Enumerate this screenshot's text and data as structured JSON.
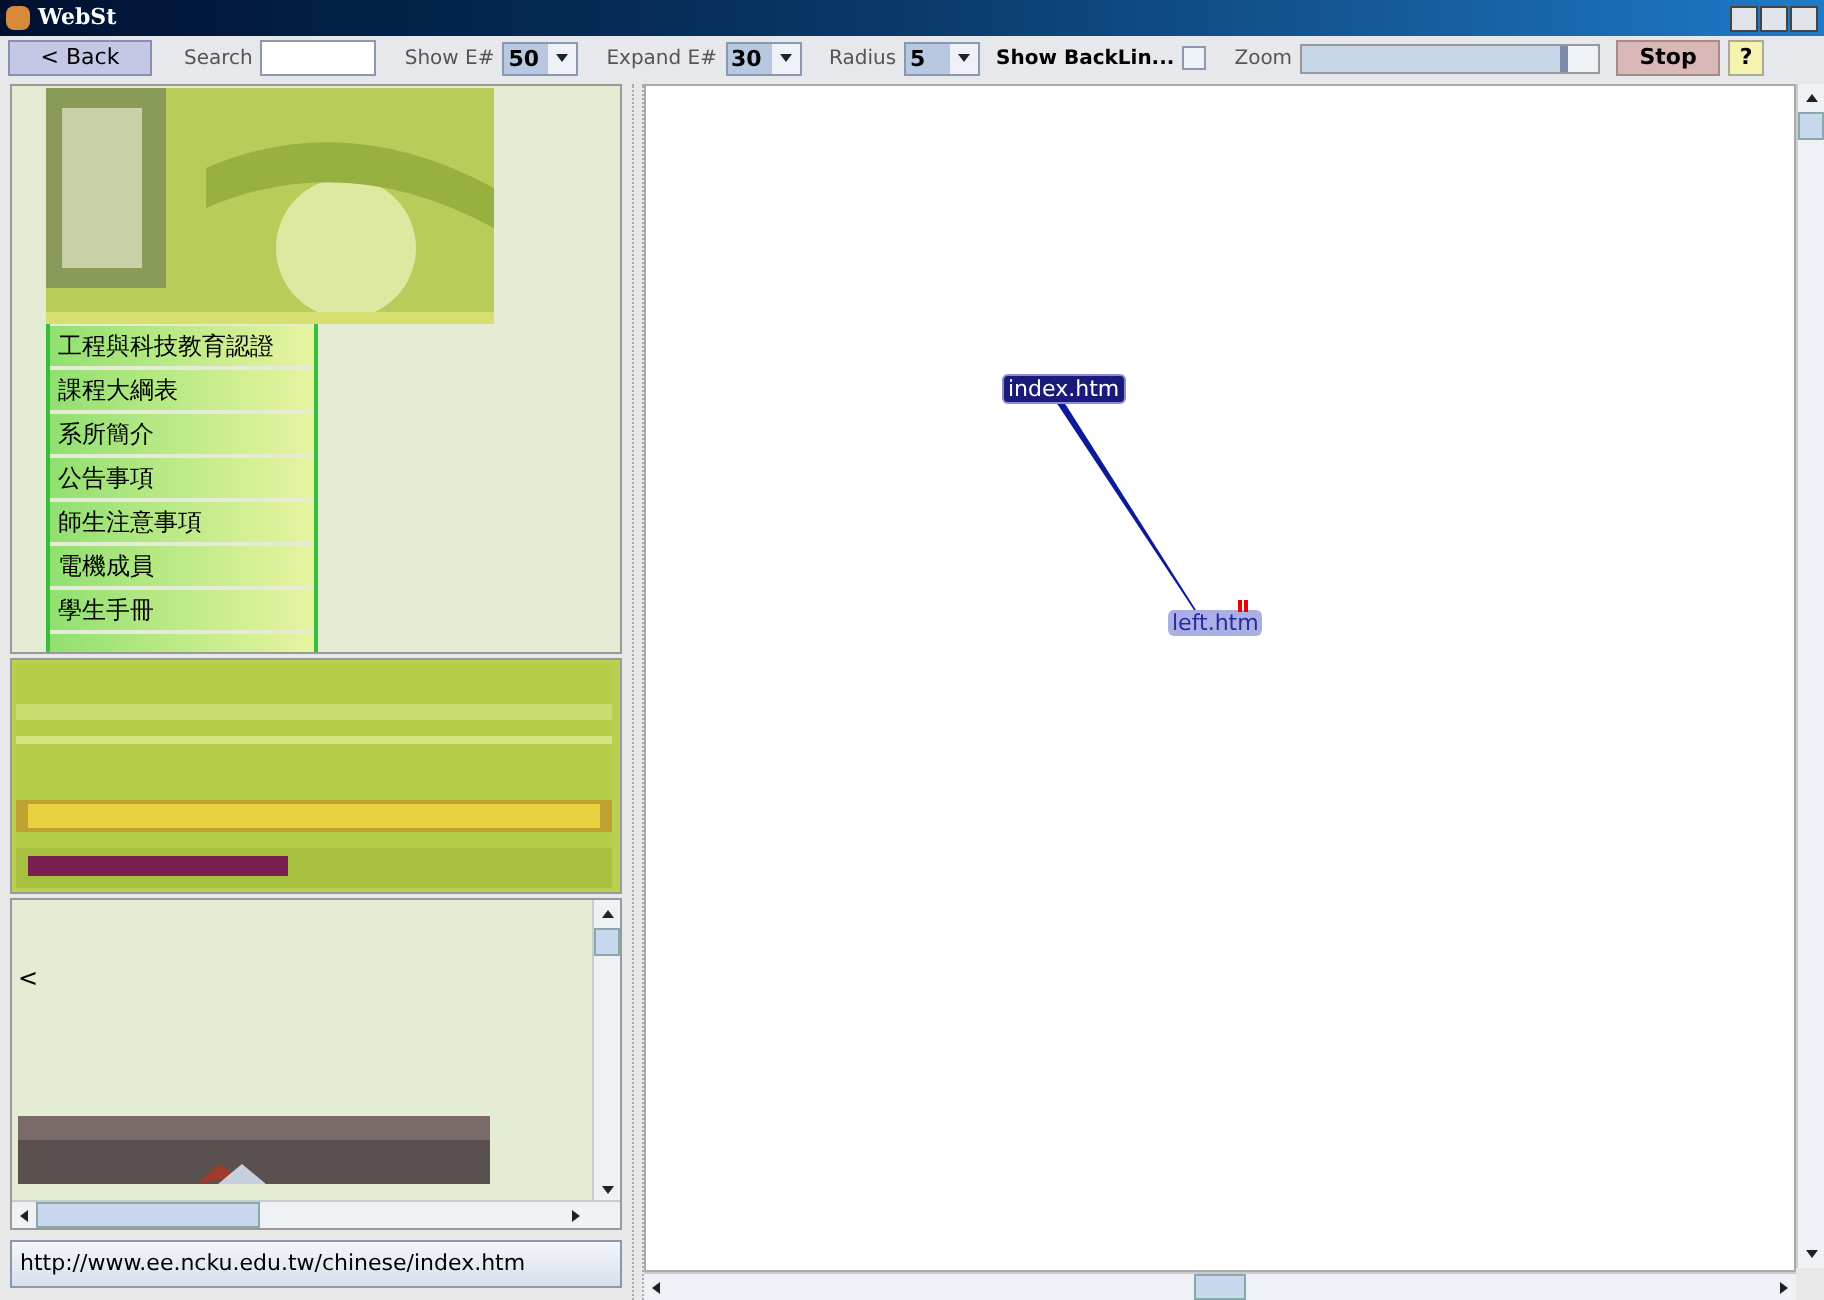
{
  "window": {
    "title": "WebSt"
  },
  "toolbar": {
    "back": "< Back",
    "search_label": "Search",
    "show_label": "Show E#",
    "show_value": "50",
    "expand_label": "Expand E#",
    "expand_value": "30",
    "radius_label": "Radius",
    "radius_value": "5",
    "backlinks_label": "Show BackLin...",
    "backlinks_checked": false,
    "zoom_label": "Zoom",
    "zoom": {
      "level": 0.9
    },
    "stop": "Stop",
    "help": "?"
  },
  "browser": {
    "menu_items": [
      "工程與科技教育認證",
      "課程大綱表",
      "系所簡介",
      "公告事項",
      "師生注意事項",
      "電機成員",
      "學生手冊"
    ],
    "frame_text": "<",
    "status_url": "http://www.ee.ncku.edu.tw/chinese/index.htm"
  },
  "graph": {
    "nodes": [
      {
        "label": "index.htm",
        "selected": true
      },
      {
        "label": "left.htm",
        "selected": false
      }
    ]
  }
}
